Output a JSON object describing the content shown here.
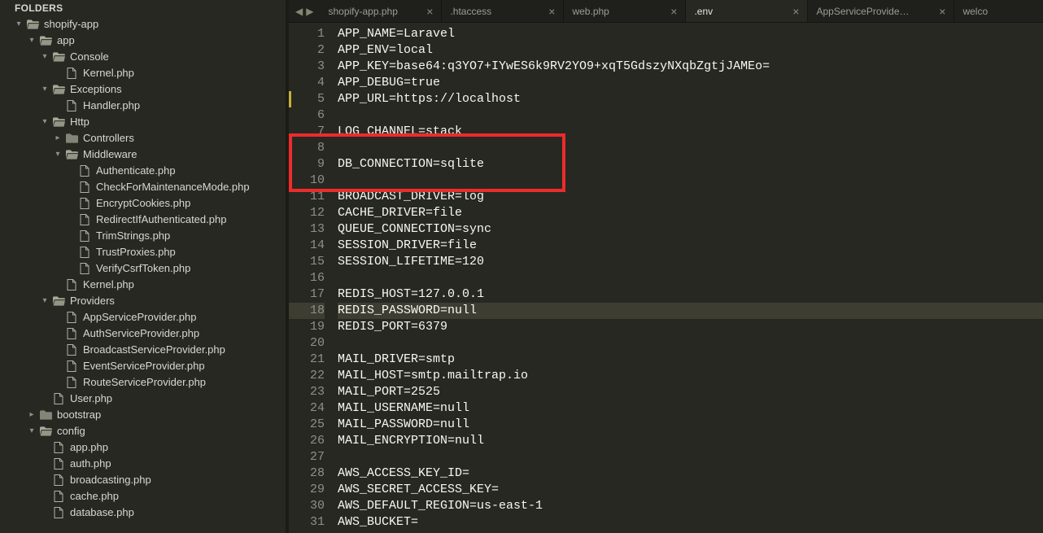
{
  "sidebar": {
    "header": "FOLDERS",
    "tree": [
      {
        "depth": 0,
        "kind": "folder-open",
        "arrow": "down",
        "label": "shopify-app"
      },
      {
        "depth": 1,
        "kind": "folder-open",
        "arrow": "down",
        "label": "app"
      },
      {
        "depth": 2,
        "kind": "folder-open",
        "arrow": "down",
        "label": "Console"
      },
      {
        "depth": 3,
        "kind": "file",
        "arrow": "",
        "label": "Kernel.php"
      },
      {
        "depth": 2,
        "kind": "folder-open",
        "arrow": "down",
        "label": "Exceptions"
      },
      {
        "depth": 3,
        "kind": "file",
        "arrow": "",
        "label": "Handler.php"
      },
      {
        "depth": 2,
        "kind": "folder-open",
        "arrow": "down",
        "label": "Http"
      },
      {
        "depth": 3,
        "kind": "folder",
        "arrow": "right",
        "label": "Controllers"
      },
      {
        "depth": 3,
        "kind": "folder-open",
        "arrow": "down",
        "label": "Middleware"
      },
      {
        "depth": 4,
        "kind": "file",
        "arrow": "",
        "label": "Authenticate.php"
      },
      {
        "depth": 4,
        "kind": "file",
        "arrow": "",
        "label": "CheckForMaintenanceMode.php"
      },
      {
        "depth": 4,
        "kind": "file",
        "arrow": "",
        "label": "EncryptCookies.php"
      },
      {
        "depth": 4,
        "kind": "file",
        "arrow": "",
        "label": "RedirectIfAuthenticated.php"
      },
      {
        "depth": 4,
        "kind": "file",
        "arrow": "",
        "label": "TrimStrings.php"
      },
      {
        "depth": 4,
        "kind": "file",
        "arrow": "",
        "label": "TrustProxies.php"
      },
      {
        "depth": 4,
        "kind": "file",
        "arrow": "",
        "label": "VerifyCsrfToken.php"
      },
      {
        "depth": 3,
        "kind": "file",
        "arrow": "",
        "label": "Kernel.php"
      },
      {
        "depth": 2,
        "kind": "folder-open",
        "arrow": "down",
        "label": "Providers"
      },
      {
        "depth": 3,
        "kind": "file",
        "arrow": "",
        "label": "AppServiceProvider.php"
      },
      {
        "depth": 3,
        "kind": "file",
        "arrow": "",
        "label": "AuthServiceProvider.php"
      },
      {
        "depth": 3,
        "kind": "file",
        "arrow": "",
        "label": "BroadcastServiceProvider.php"
      },
      {
        "depth": 3,
        "kind": "file",
        "arrow": "",
        "label": "EventServiceProvider.php"
      },
      {
        "depth": 3,
        "kind": "file",
        "arrow": "",
        "label": "RouteServiceProvider.php"
      },
      {
        "depth": 2,
        "kind": "file",
        "arrow": "",
        "label": "User.php"
      },
      {
        "depth": 1,
        "kind": "folder",
        "arrow": "right",
        "label": "bootstrap"
      },
      {
        "depth": 1,
        "kind": "folder-open",
        "arrow": "down",
        "label": "config"
      },
      {
        "depth": 2,
        "kind": "file",
        "arrow": "",
        "label": "app.php"
      },
      {
        "depth": 2,
        "kind": "file",
        "arrow": "",
        "label": "auth.php"
      },
      {
        "depth": 2,
        "kind": "file",
        "arrow": "",
        "label": "broadcasting.php"
      },
      {
        "depth": 2,
        "kind": "file",
        "arrow": "",
        "label": "cache.php"
      },
      {
        "depth": 2,
        "kind": "file",
        "arrow": "",
        "label": "database.php"
      }
    ]
  },
  "tabs": [
    {
      "label": "shopify-app.php",
      "active": false
    },
    {
      "label": ".htaccess",
      "active": false
    },
    {
      "label": "web.php",
      "active": false
    },
    {
      "label": ".env",
      "active": true
    },
    {
      "label": "AppServiceProvider.php",
      "active": false
    },
    {
      "label": "welco",
      "active": false,
      "last": true
    }
  ],
  "code": {
    "start_line": 1,
    "modified_line": 5,
    "highlight_line": 18,
    "redbox": {
      "from_line": 8,
      "to_line": 10
    },
    "lines": [
      "APP_NAME=Laravel",
      "APP_ENV=local",
      "APP_KEY=base64:q3YO7+IYwES6k9RV2YO9+xqT5GdszyNXqbZgtjJAMEo=",
      "APP_DEBUG=true",
      "APP_URL=https://localhost",
      "",
      "LOG_CHANNEL=stack",
      "",
      "DB_CONNECTION=sqlite",
      "",
      "BROADCAST_DRIVER=log",
      "CACHE_DRIVER=file",
      "QUEUE_CONNECTION=sync",
      "SESSION_DRIVER=file",
      "SESSION_LIFETIME=120",
      "",
      "REDIS_HOST=127.0.0.1",
      "REDIS_PASSWORD=null",
      "REDIS_PORT=6379",
      "",
      "MAIL_DRIVER=smtp",
      "MAIL_HOST=smtp.mailtrap.io",
      "MAIL_PORT=2525",
      "MAIL_USERNAME=null",
      "MAIL_PASSWORD=null",
      "MAIL_ENCRYPTION=null",
      "",
      "AWS_ACCESS_KEY_ID=",
      "AWS_SECRET_ACCESS_KEY=",
      "AWS_DEFAULT_REGION=us-east-1",
      "AWS_BUCKET="
    ]
  }
}
